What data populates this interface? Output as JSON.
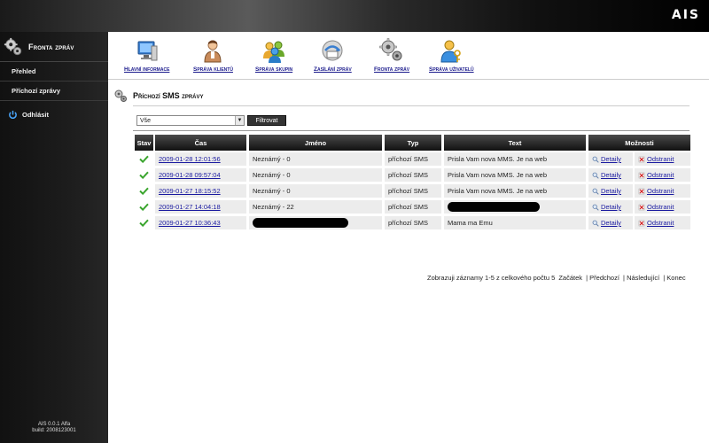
{
  "brand": {
    "logo": "AIS"
  },
  "sidebar": {
    "title": "Fronta zpráv",
    "items": [
      {
        "label": "Přehled"
      },
      {
        "label": "Příchozí zprávy"
      }
    ],
    "logout_label": "Odhlásit",
    "version_line1": "AIS 0.0.1 Alfa",
    "version_line2": "build: 2008123001"
  },
  "toolbar": {
    "items": [
      {
        "label": "Hlavní informace",
        "icon": "monitor-icon"
      },
      {
        "label": "Správa klientů",
        "icon": "person-icon"
      },
      {
        "label": "Správa skupin",
        "icon": "group-icon"
      },
      {
        "label": "Zasílání zpráv",
        "icon": "mail-arrow-icon"
      },
      {
        "label": "Fronta zpráv",
        "icon": "gears-icon"
      },
      {
        "label": "Správa uživatelů",
        "icon": "user-key-icon"
      }
    ]
  },
  "page": {
    "title": "Příchozí SMS zprávy"
  },
  "filter": {
    "selected": "Vše",
    "button_label": "Filtrovat"
  },
  "table": {
    "headers": [
      "Stav",
      "Čas",
      "Jméno",
      "Typ",
      "Text",
      "Možnosti"
    ],
    "rows": [
      {
        "time": "2009-01-28 12:01:56",
        "name": "Neznámý  -  0",
        "type": "příchozí SMS",
        "text": "Prisla Vam nova MMS. Je na web",
        "name_redacted": false,
        "text_redacted": false
      },
      {
        "time": "2009-01-28 09:57:04",
        "name": "Neznámý  -  0",
        "type": "příchozí SMS",
        "text": "Prisla Vam nova MMS. Je na web",
        "name_redacted": false,
        "text_redacted": false
      },
      {
        "time": "2009-01-27 18:15:52",
        "name": "Neznámý  -  0",
        "type": "příchozí SMS",
        "text": "Prisla Vam nova MMS. Je na web",
        "name_redacted": false,
        "text_redacted": false
      },
      {
        "time": "2009-01-27 14:04:18",
        "name": "Neznámý  -  22",
        "type": "příchozí SMS",
        "text": "",
        "name_redacted": false,
        "text_redacted": true
      },
      {
        "time": "2009-01-27 10:36:43",
        "name": "",
        "type": "příchozí SMS",
        "text": "Mama ma Emu",
        "name_redacted": true,
        "text_redacted": false
      }
    ],
    "detail_label": "Detaily",
    "delete_label": "Odstranit"
  },
  "pager": {
    "summary": "Zobrazuji záznamy 1-5 z celkového počtu 5",
    "first": "Začátek",
    "prev": "| Předchozí",
    "next": "| Následující",
    "last": "| Konec"
  },
  "colors": {
    "link": "#1a1aa0",
    "check": "#3aa52e",
    "header_bg": "#111111"
  }
}
